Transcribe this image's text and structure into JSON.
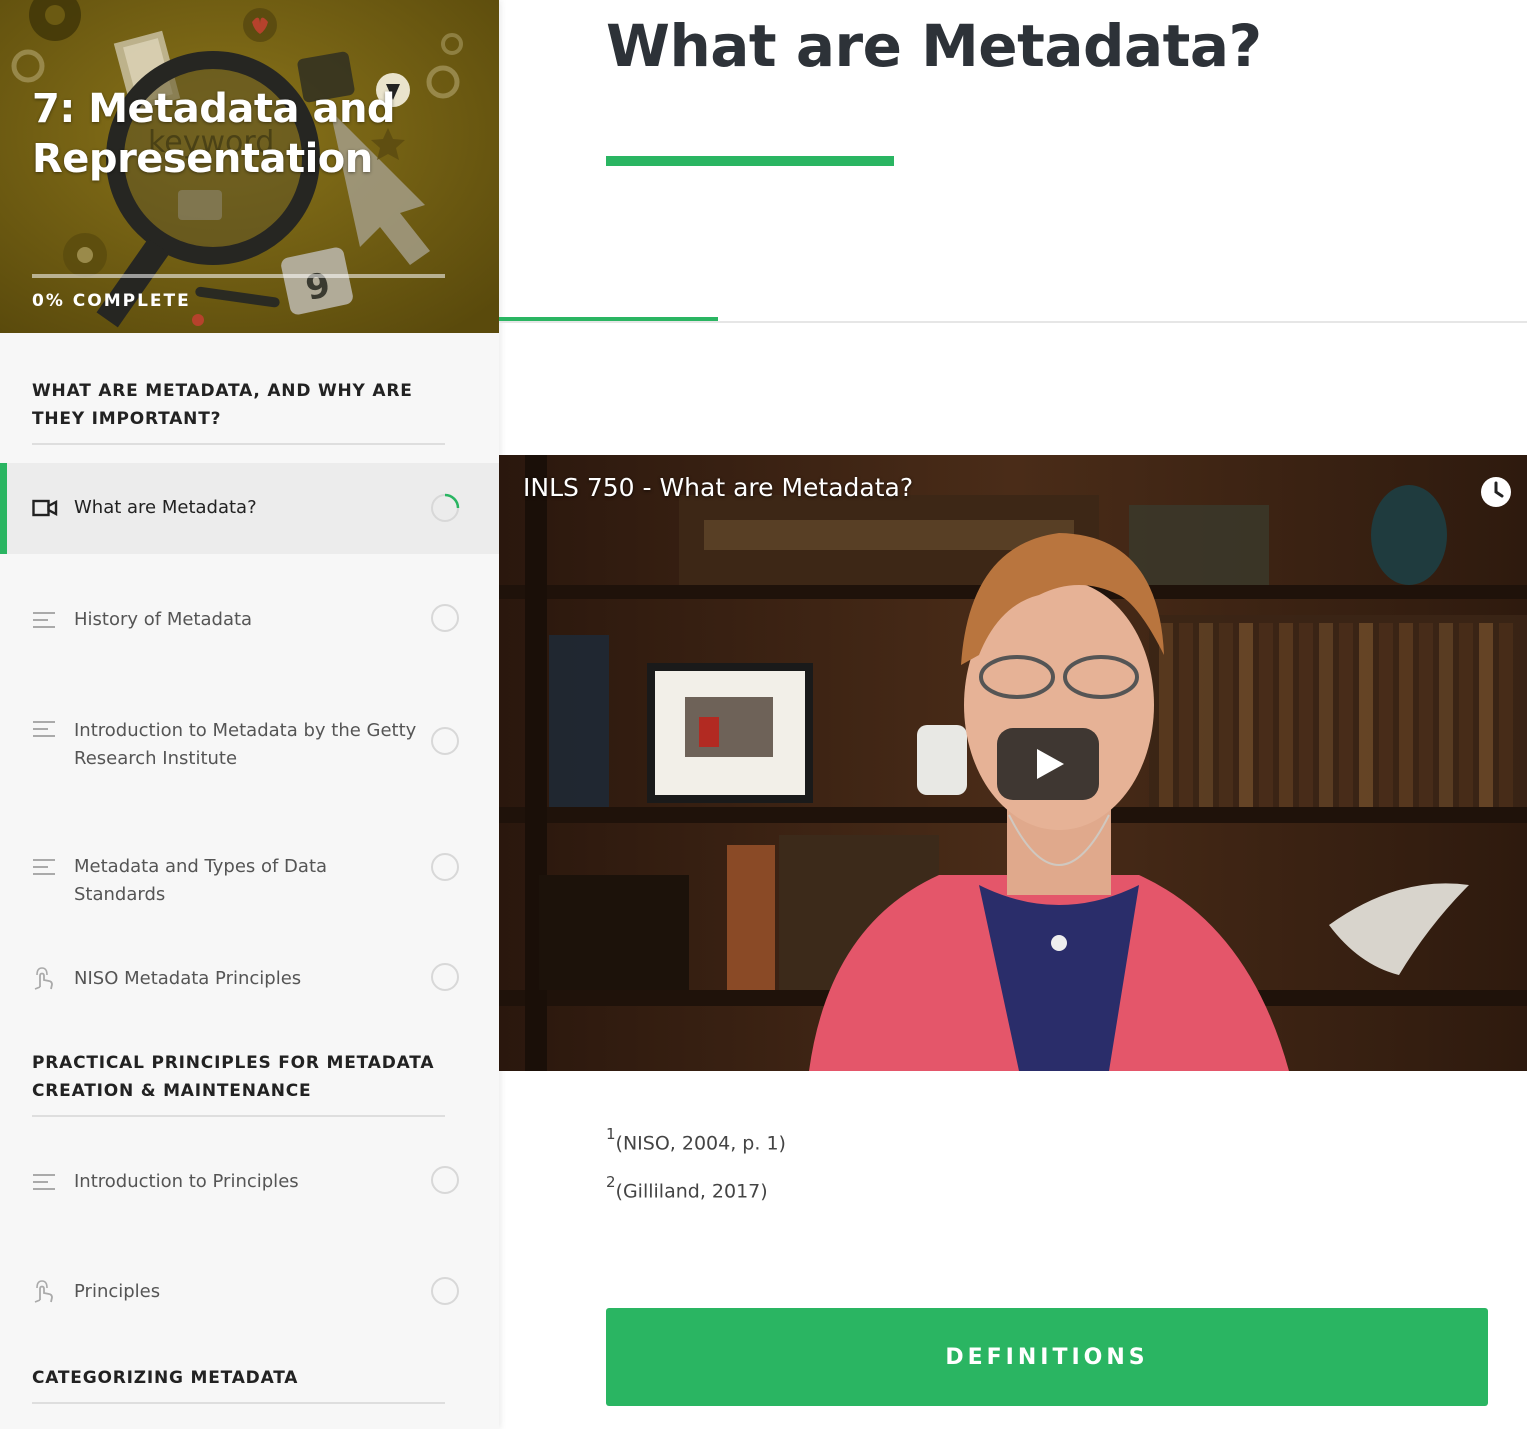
{
  "course": {
    "title": "7: Metadata and Representation",
    "progress_label": "0% COMPLETE",
    "progress_percent": 0
  },
  "sidebar": {
    "sections": [
      {
        "heading": "WHAT ARE METADATA, AND WHY ARE THEY IMPORTANT?"
      },
      {
        "heading": "PRACTICAL PRINCIPLES FOR METADATA CREATION & MAINTENANCE"
      },
      {
        "heading": "CATEGORIZING METADATA"
      }
    ],
    "lessons": [
      {
        "label": "What are Metadata?",
        "icon": "video-icon",
        "state": "in-progress",
        "active": true
      },
      {
        "label": "History of Metadata",
        "icon": "text-lines-icon",
        "state": "not-started",
        "active": false
      },
      {
        "label": "Introduction to Metadata by the Getty Research Institute",
        "icon": "text-lines-icon",
        "state": "not-started",
        "active": false
      },
      {
        "label": "Metadata and Types of Data Standards",
        "icon": "text-lines-icon",
        "state": "not-started",
        "active": false
      },
      {
        "label": "NISO Metadata Principles",
        "icon": "interactive-hand-icon",
        "state": "not-started",
        "active": false
      },
      {
        "label": "Introduction to Principles",
        "icon": "text-lines-icon",
        "state": "not-started",
        "active": false
      },
      {
        "label": "Principles",
        "icon": "interactive-hand-icon",
        "state": "not-started",
        "active": false
      }
    ]
  },
  "main": {
    "page_title": "What are Metadata?",
    "video": {
      "title": "INLS 750 - What are Metadata?",
      "play_icon": "play-icon",
      "watch_later_icon": "clock-icon"
    },
    "footnotes": [
      {
        "marker": "1",
        "text": "(NISO, 2004, p. 1)"
      },
      {
        "marker": "2",
        "text": "(Gilliland, 2017)"
      }
    ],
    "next_button_label": "DEFINITIONS"
  },
  "colors": {
    "accent": "#2ab562",
    "header_bg": "#6f5c10",
    "title_text": "#2d3238",
    "sidebar_bg": "#f7f7f7"
  }
}
